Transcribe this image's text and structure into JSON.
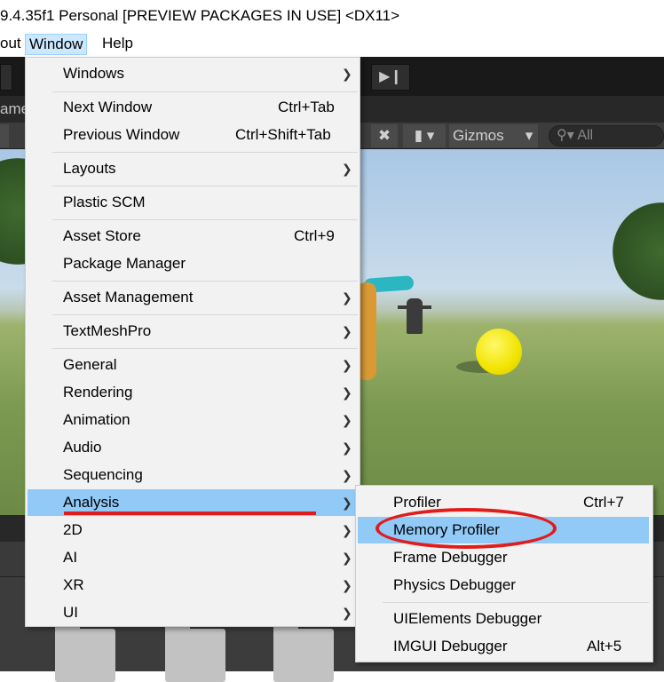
{
  "window": {
    "title": "9.4.35f1 Personal [PREVIEW PACKAGES IN USE] <DX11>"
  },
  "menubar": {
    "items": [
      "out",
      "Window",
      "Help"
    ]
  },
  "editor": {
    "tab_label_fragment": "ame",
    "gizmos_label": "Gizmos",
    "search_placeholder": "All"
  },
  "window_menu": {
    "items": [
      {
        "label": "Windows",
        "shortcut": "",
        "submenu": true
      },
      {
        "label": "Next Window",
        "shortcut": "Ctrl+Tab",
        "submenu": false
      },
      {
        "label": "Previous Window",
        "shortcut": "Ctrl+Shift+Tab",
        "submenu": false
      },
      {
        "label": "Layouts",
        "shortcut": "",
        "submenu": true
      },
      {
        "label": "Plastic SCM",
        "shortcut": "",
        "submenu": false
      },
      {
        "label": "Asset Store",
        "shortcut": "Ctrl+9",
        "submenu": false
      },
      {
        "label": "Package Manager",
        "shortcut": "",
        "submenu": false
      },
      {
        "label": "Asset Management",
        "shortcut": "",
        "submenu": true
      },
      {
        "label": "TextMeshPro",
        "shortcut": "",
        "submenu": true
      },
      {
        "label": "General",
        "shortcut": "",
        "submenu": true
      },
      {
        "label": "Rendering",
        "shortcut": "",
        "submenu": true
      },
      {
        "label": "Animation",
        "shortcut": "",
        "submenu": true
      },
      {
        "label": "Audio",
        "shortcut": "",
        "submenu": true
      },
      {
        "label": "Sequencing",
        "shortcut": "",
        "submenu": true
      },
      {
        "label": "Analysis",
        "shortcut": "",
        "submenu": true,
        "highlighted": true
      },
      {
        "label": "2D",
        "shortcut": "",
        "submenu": true
      },
      {
        "label": "AI",
        "shortcut": "",
        "submenu": true
      },
      {
        "label": "XR",
        "shortcut": "",
        "submenu": true
      },
      {
        "label": "UI",
        "shortcut": "",
        "submenu": true
      }
    ]
  },
  "analysis_submenu": {
    "items": [
      {
        "label": "Profiler",
        "shortcut": "Ctrl+7"
      },
      {
        "label": "Memory Profiler",
        "shortcut": "",
        "highlighted": true
      },
      {
        "label": "Frame Debugger",
        "shortcut": ""
      },
      {
        "label": "Physics Debugger",
        "shortcut": ""
      },
      {
        "label": "UIElements Debugger",
        "shortcut": ""
      },
      {
        "label": "IMGUI Debugger",
        "shortcut": "Alt+5"
      }
    ]
  },
  "icons": {
    "submenu_arrow": "chevron-right-icon",
    "step": "step-forward-icon",
    "tools": "tools-icon",
    "camera": "camera-icon",
    "dropdown": "chevron-down-icon",
    "search": "search-icon"
  },
  "colors": {
    "menu_background": "#f2f2f2",
    "menu_highlight": "#91c9f7",
    "menubar_active": "#cce8ff",
    "annotation_red": "#e01c1c"
  }
}
